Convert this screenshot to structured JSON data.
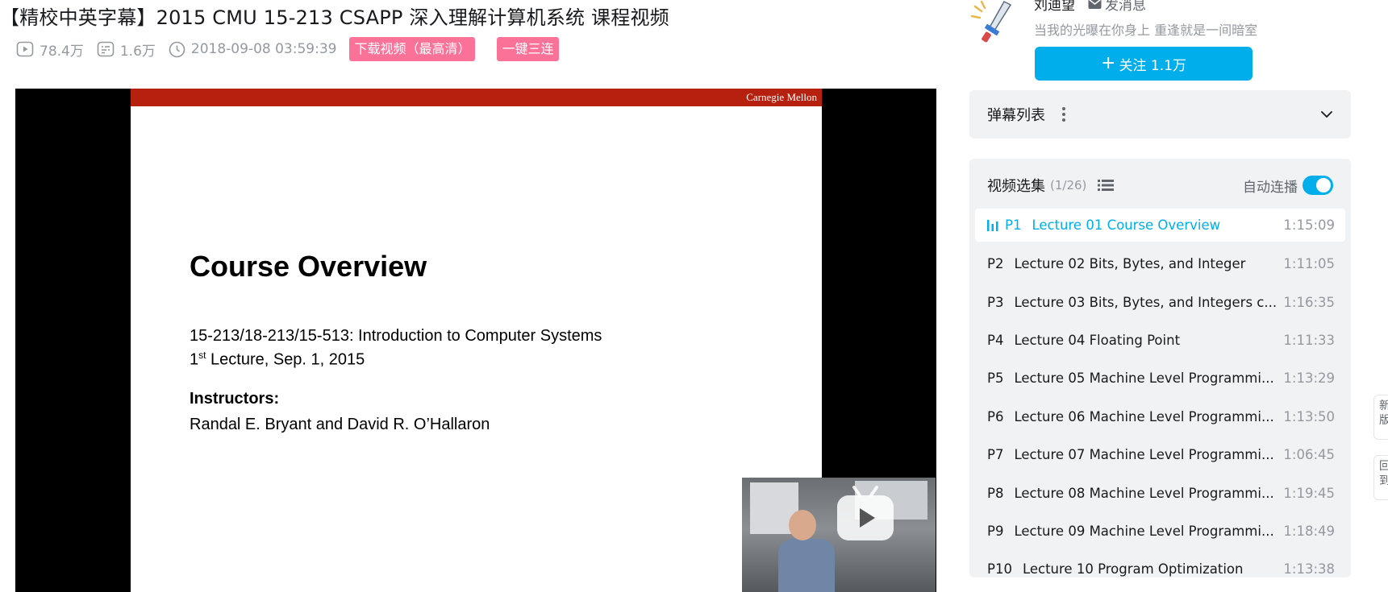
{
  "video": {
    "title": "【精校中英字幕】2015 CMU 15-213 CSAPP 深入理解计算机系统 课程视频",
    "views": "78.4万",
    "danmaku_count": "1.6万",
    "pubdate": "2018-09-08 03:59:39",
    "tags": [
      "下载视频（最高清）",
      "一键三连"
    ]
  },
  "slide": {
    "header": "Carnegie Mellon",
    "title": "Course Overview",
    "course": "15-213/18-213/15-513: Introduction to Computer Systems",
    "lecture_num": "1",
    "lecture_sup": "st",
    "lecture_rest": " Lecture, Sep. 1, 2015",
    "instructors_label": "Instructors:",
    "instructors": "Randal E. Bryant and David R. O’Hallaron"
  },
  "uploader": {
    "name": "刘迪望",
    "message_label": "发消息",
    "description": "当我的光曝在你身上 重逢就是一间暗室",
    "follow_label": "关注 1.1万"
  },
  "danmaku_list": {
    "label": "弹幕列表"
  },
  "playlist": {
    "title": "视频选集",
    "count": "(1/26)",
    "autoplay_label": "自动连播",
    "autoplay_on": true,
    "episodes": [
      {
        "p": "P1",
        "title": "Lecture 01 Course Overview",
        "duration": "1:15:09",
        "active": true
      },
      {
        "p": "P2",
        "title": "Lecture 02 Bits, Bytes, and Integer",
        "duration": "1:11:05"
      },
      {
        "p": "P3",
        "title": "Lecture 03 Bits, Bytes, and Integers c...",
        "duration": "1:16:35"
      },
      {
        "p": "P4",
        "title": "Lecture 04 Floating Point",
        "duration": "1:11:33"
      },
      {
        "p": "P5",
        "title": "Lecture 05 Machine Level Programmi...",
        "duration": "1:13:29"
      },
      {
        "p": "P6",
        "title": "Lecture 06 Machine Level Programmi...",
        "duration": "1:13:50"
      },
      {
        "p": "P7",
        "title": "Lecture 07 Machine Level Programmi...",
        "duration": "1:06:45"
      },
      {
        "p": "P8",
        "title": "Lecture 08 Machine Level Programmi...",
        "duration": "1:19:45"
      },
      {
        "p": "P9",
        "title": "Lecture 09 Machine Level Programmi...",
        "duration": "1:18:49"
      },
      {
        "p": "P10",
        "title": "Lecture 10 Program Optimization",
        "duration": "1:13:38"
      }
    ]
  },
  "float_buttons": [
    "新版",
    "回到"
  ],
  "colors": {
    "accent": "#00aeec",
    "tag_pink": "#fb7299",
    "slide_bar": "#b5200f",
    "muted_text": "#9499a0",
    "panel_bg": "#f1f2f3"
  },
  "icons": [
    "play-count-icon",
    "danmaku-count-icon",
    "clock-icon",
    "mail-icon",
    "more-dots-icon",
    "chevron-down-icon",
    "list-icon",
    "playing-bars-icon",
    "play-button-icon"
  ]
}
